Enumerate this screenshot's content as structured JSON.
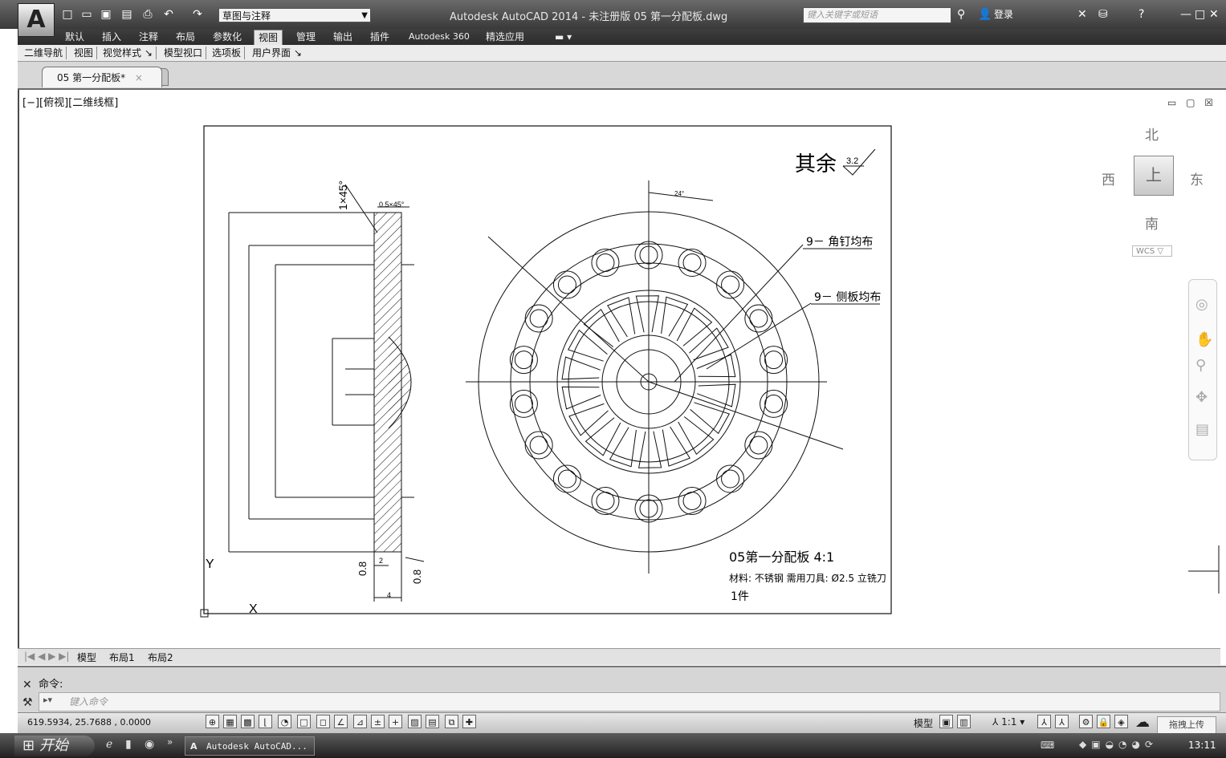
{
  "titlebar": {
    "app_letter": "A",
    "workspace": "草图与注释",
    "title": "Autodesk AutoCAD 2014 - 未注册版    05 第一分配板.dwg",
    "search_placeholder": "键入关键字或短语",
    "login": "登录"
  },
  "ribbon": {
    "tabs": [
      "默认",
      "插入",
      "注释",
      "布局",
      "参数化",
      "视图",
      "管理",
      "输出",
      "插件",
      "Autodesk 360",
      "精选应用"
    ],
    "active_tab": "视图",
    "panels": [
      "二维导航",
      "视图",
      "视觉样式 ↘",
      "模型视口",
      "选项板",
      "用户界面 ↘"
    ]
  },
  "file_tab": {
    "name": "05 第一分配板*",
    "close": "×"
  },
  "viewport": {
    "label": "[−][俯视][二维线框]",
    "controls": "▭ ▢ ☒"
  },
  "viewcube": {
    "north": "北",
    "south": "南",
    "east": "东",
    "west": "西",
    "top": "上",
    "wcs": "WCS ▽"
  },
  "drawing": {
    "surface": "其余",
    "roughness": "3.2",
    "chamfer_label": "1×45°",
    "chamfer_small": "0.5×45°",
    "angle": "24°",
    "note1": "9－ 角钉均布",
    "note2": "9－ 侧板均布",
    "title_line": "05第一分配板 4:1",
    "material_line": "材料: 不锈钢  需用刀具: Ø2.5 立铣刀",
    "qty": "1件",
    "rough_a": "0.8",
    "rough_b": "0.8",
    "dim_bottom": "4",
    "dim_bottom2": "2",
    "ucs_y": "Y",
    "ucs_x": "X"
  },
  "layout_tabs": [
    "模型",
    "布局1",
    "布局2"
  ],
  "command": {
    "history": "命令:",
    "placeholder": "键入命令"
  },
  "status": {
    "coords": "619.5934,   25.7688  ,  0.0000",
    "model": "模型",
    "scale": "1:1",
    "upload": "拖拽上传"
  },
  "taskbar": {
    "start": "开始",
    "task": "Autodesk AutoCAD...",
    "clock": "13:11"
  }
}
